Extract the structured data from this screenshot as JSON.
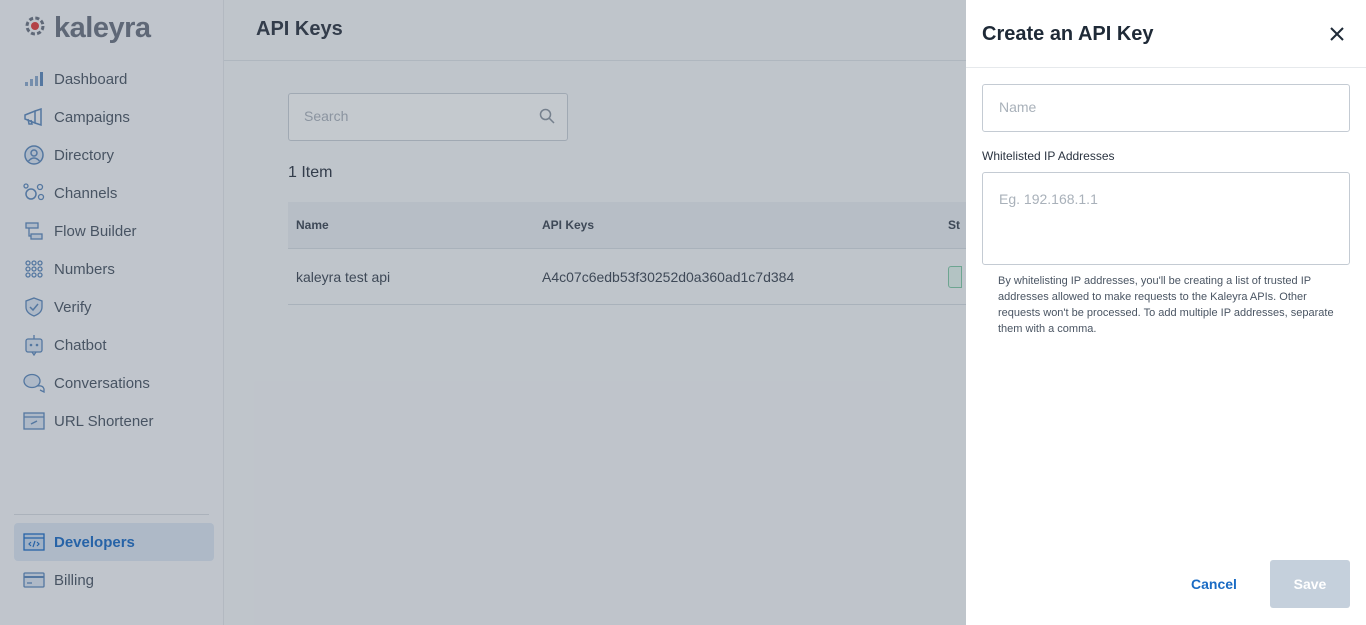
{
  "brand": {
    "name": "kaleyra",
    "logo_icon": "kaleyra-logo-icon",
    "accent": "#e23b3b"
  },
  "sidebar": {
    "items": [
      {
        "label": "Dashboard",
        "icon": "bar-chart-icon"
      },
      {
        "label": "Campaigns",
        "icon": "megaphone-icon"
      },
      {
        "label": "Directory",
        "icon": "user-circle-icon"
      },
      {
        "label": "Channels",
        "icon": "channels-network-icon"
      },
      {
        "label": "Flow Builder",
        "icon": "flow-builder-icon"
      },
      {
        "label": "Numbers",
        "icon": "dialpad-icon"
      },
      {
        "label": "Verify",
        "icon": "shield-check-icon"
      },
      {
        "label": "Chatbot",
        "icon": "robot-icon"
      },
      {
        "label": "Conversations",
        "icon": "chat-bubbles-icon"
      },
      {
        "label": "URL Shortener",
        "icon": "link-window-icon"
      }
    ],
    "bottom_items": [
      {
        "label": "Developers",
        "icon": "code-window-icon",
        "active": true
      },
      {
        "label": "Billing",
        "icon": "credit-card-icon"
      }
    ]
  },
  "main": {
    "title": "API Keys",
    "search": {
      "placeholder": "Search"
    },
    "item_count": "1 Item",
    "table": {
      "headers": [
        "Name",
        "API Keys",
        "St"
      ],
      "rows": [
        {
          "name": "kaleyra test api",
          "api_key": "A4c07c6edb53f30252d0a360ad1c7d384"
        }
      ]
    }
  },
  "drawer": {
    "title": "Create an API Key",
    "name_placeholder": "Name",
    "ip_label": "Whitelisted IP Addresses",
    "ip_placeholder": "Eg. 192.168.1.1",
    "ip_help": "By whitelisting IP addresses, you'll be creating a list of trusted IP addresses allowed to make requests to the Kaleyra APIs. Other requests won't be processed. To add multiple IP addresses, separate them with a comma.",
    "cancel_label": "Cancel",
    "save_label": "Save"
  },
  "colors": {
    "link_blue": "#1a6bc4",
    "save_disabled": "#c5d0dc",
    "status_green": "#7fc9a5"
  }
}
